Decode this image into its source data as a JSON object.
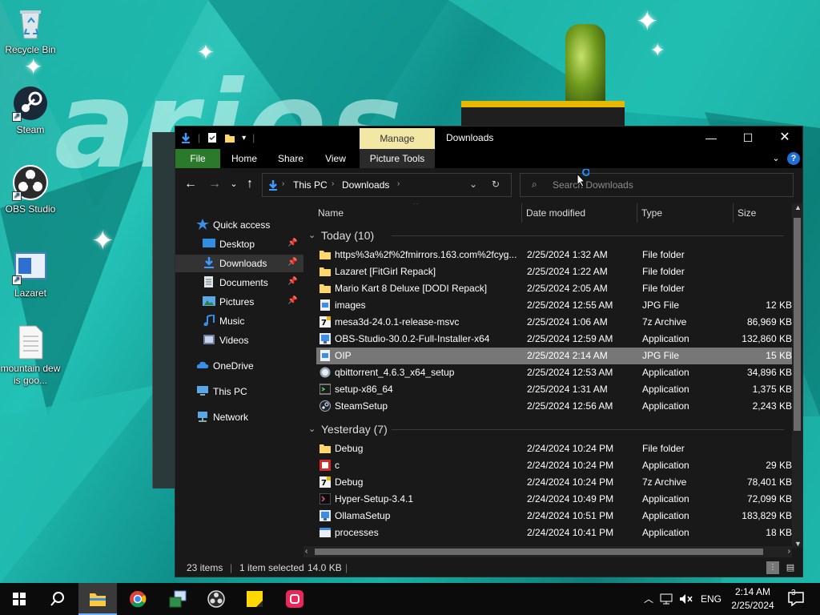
{
  "desktop": {
    "icons": [
      {
        "label": "Recycle Bin",
        "icon": "recycle-bin-icon"
      },
      {
        "label": "Steam",
        "icon": "steam-icon"
      },
      {
        "label": "OBS Studio",
        "icon": "obs-icon"
      },
      {
        "label": "Lazaret",
        "icon": "lazaret-icon"
      },
      {
        "label": "mountain dew is goo...",
        "icon": "text-file-icon"
      }
    ]
  },
  "explorer": {
    "title": "Downloads",
    "manage_tab": "Manage",
    "ribbon_tabs": [
      "File",
      "Home",
      "Share",
      "View",
      "Picture Tools"
    ],
    "breadcrumb": [
      "This PC",
      "Downloads"
    ],
    "search_placeholder": "Search Downloads",
    "nav": {
      "quick_access": "Quick access",
      "items": [
        "Desktop",
        "Downloads",
        "Documents",
        "Pictures",
        "Music",
        "Videos"
      ],
      "onedrive": "OneDrive",
      "this_pc": "This PC",
      "network": "Network"
    },
    "columns": {
      "name": "Name",
      "date": "Date modified",
      "type": "Type",
      "size": "Size"
    },
    "groups": [
      {
        "label": "Today (10)",
        "rows": [
          {
            "name": "https%3a%2f%2fmirrors.163.com%2fcyg...",
            "date": "2/25/2024 1:32 AM",
            "type": "File folder",
            "size": "",
            "icon": "folder-icon"
          },
          {
            "name": "Lazaret [FitGirl Repack]",
            "date": "2/25/2024 1:22 AM",
            "type": "File folder",
            "size": "",
            "icon": "folder-icon"
          },
          {
            "name": "Mario Kart 8 Deluxe [DODI Repack]",
            "date": "2/25/2024 2:05 AM",
            "type": "File folder",
            "size": "",
            "icon": "folder-icon"
          },
          {
            "name": "images",
            "date": "2/25/2024 12:55 AM",
            "type": "JPG File",
            "size": "12 KB",
            "icon": "image-file-icon"
          },
          {
            "name": "mesa3d-24.0.1-release-msvc",
            "date": "2/25/2024 1:06 AM",
            "type": "7z Archive",
            "size": "86,969 KB",
            "icon": "archive-icon"
          },
          {
            "name": "OBS-Studio-30.0.2-Full-Installer-x64",
            "date": "2/25/2024 12:59 AM",
            "type": "Application",
            "size": "132,860 KB",
            "icon": "installer-icon"
          },
          {
            "name": "OIP",
            "date": "2/25/2024 2:14 AM",
            "type": "JPG File",
            "size": "15 KB",
            "icon": "image-file-icon",
            "selected": true
          },
          {
            "name": "qbittorrent_4.6.3_x64_setup",
            "date": "2/25/2024 12:53 AM",
            "type": "Application",
            "size": "34,896 KB",
            "icon": "qbittorrent-icon"
          },
          {
            "name": "setup-x86_64",
            "date": "2/25/2024 1:31 AM",
            "type": "Application",
            "size": "1,375 KB",
            "icon": "terminal-icon"
          },
          {
            "name": "SteamSetup",
            "date": "2/25/2024 12:56 AM",
            "type": "Application",
            "size": "2,243 KB",
            "icon": "steam-icon"
          }
        ]
      },
      {
        "label": "Yesterday (7)",
        "rows": [
          {
            "name": "Debug",
            "date": "2/24/2024 10:24 PM",
            "type": "File folder",
            "size": "",
            "icon": "folder-icon"
          },
          {
            "name": "c",
            "date": "2/24/2024 10:24 PM",
            "type": "Application",
            "size": "29 KB",
            "icon": "app-red-icon"
          },
          {
            "name": "Debug",
            "date": "2/24/2024 10:24 PM",
            "type": "7z Archive",
            "size": "78,401 KB",
            "icon": "archive-icon"
          },
          {
            "name": "Hyper-Setup-3.4.1",
            "date": "2/24/2024 10:49 PM",
            "type": "Application",
            "size": "72,099 KB",
            "icon": "hyper-icon"
          },
          {
            "name": "OllamaSetup",
            "date": "2/24/2024 10:51 PM",
            "type": "Application",
            "size": "183,829 KB",
            "icon": "installer-icon"
          },
          {
            "name": "processes",
            "date": "2/24/2024 10:41 PM",
            "type": "Application",
            "size": "18 KB",
            "icon": "window-app-icon"
          }
        ]
      }
    ],
    "status": {
      "items": "23 items",
      "selected": "1 item selected",
      "size": "14.0 KB"
    }
  },
  "taskbar": {
    "language": "ENG",
    "time": "2:14 AM",
    "date": "2/25/2024",
    "notifications": "3"
  }
}
